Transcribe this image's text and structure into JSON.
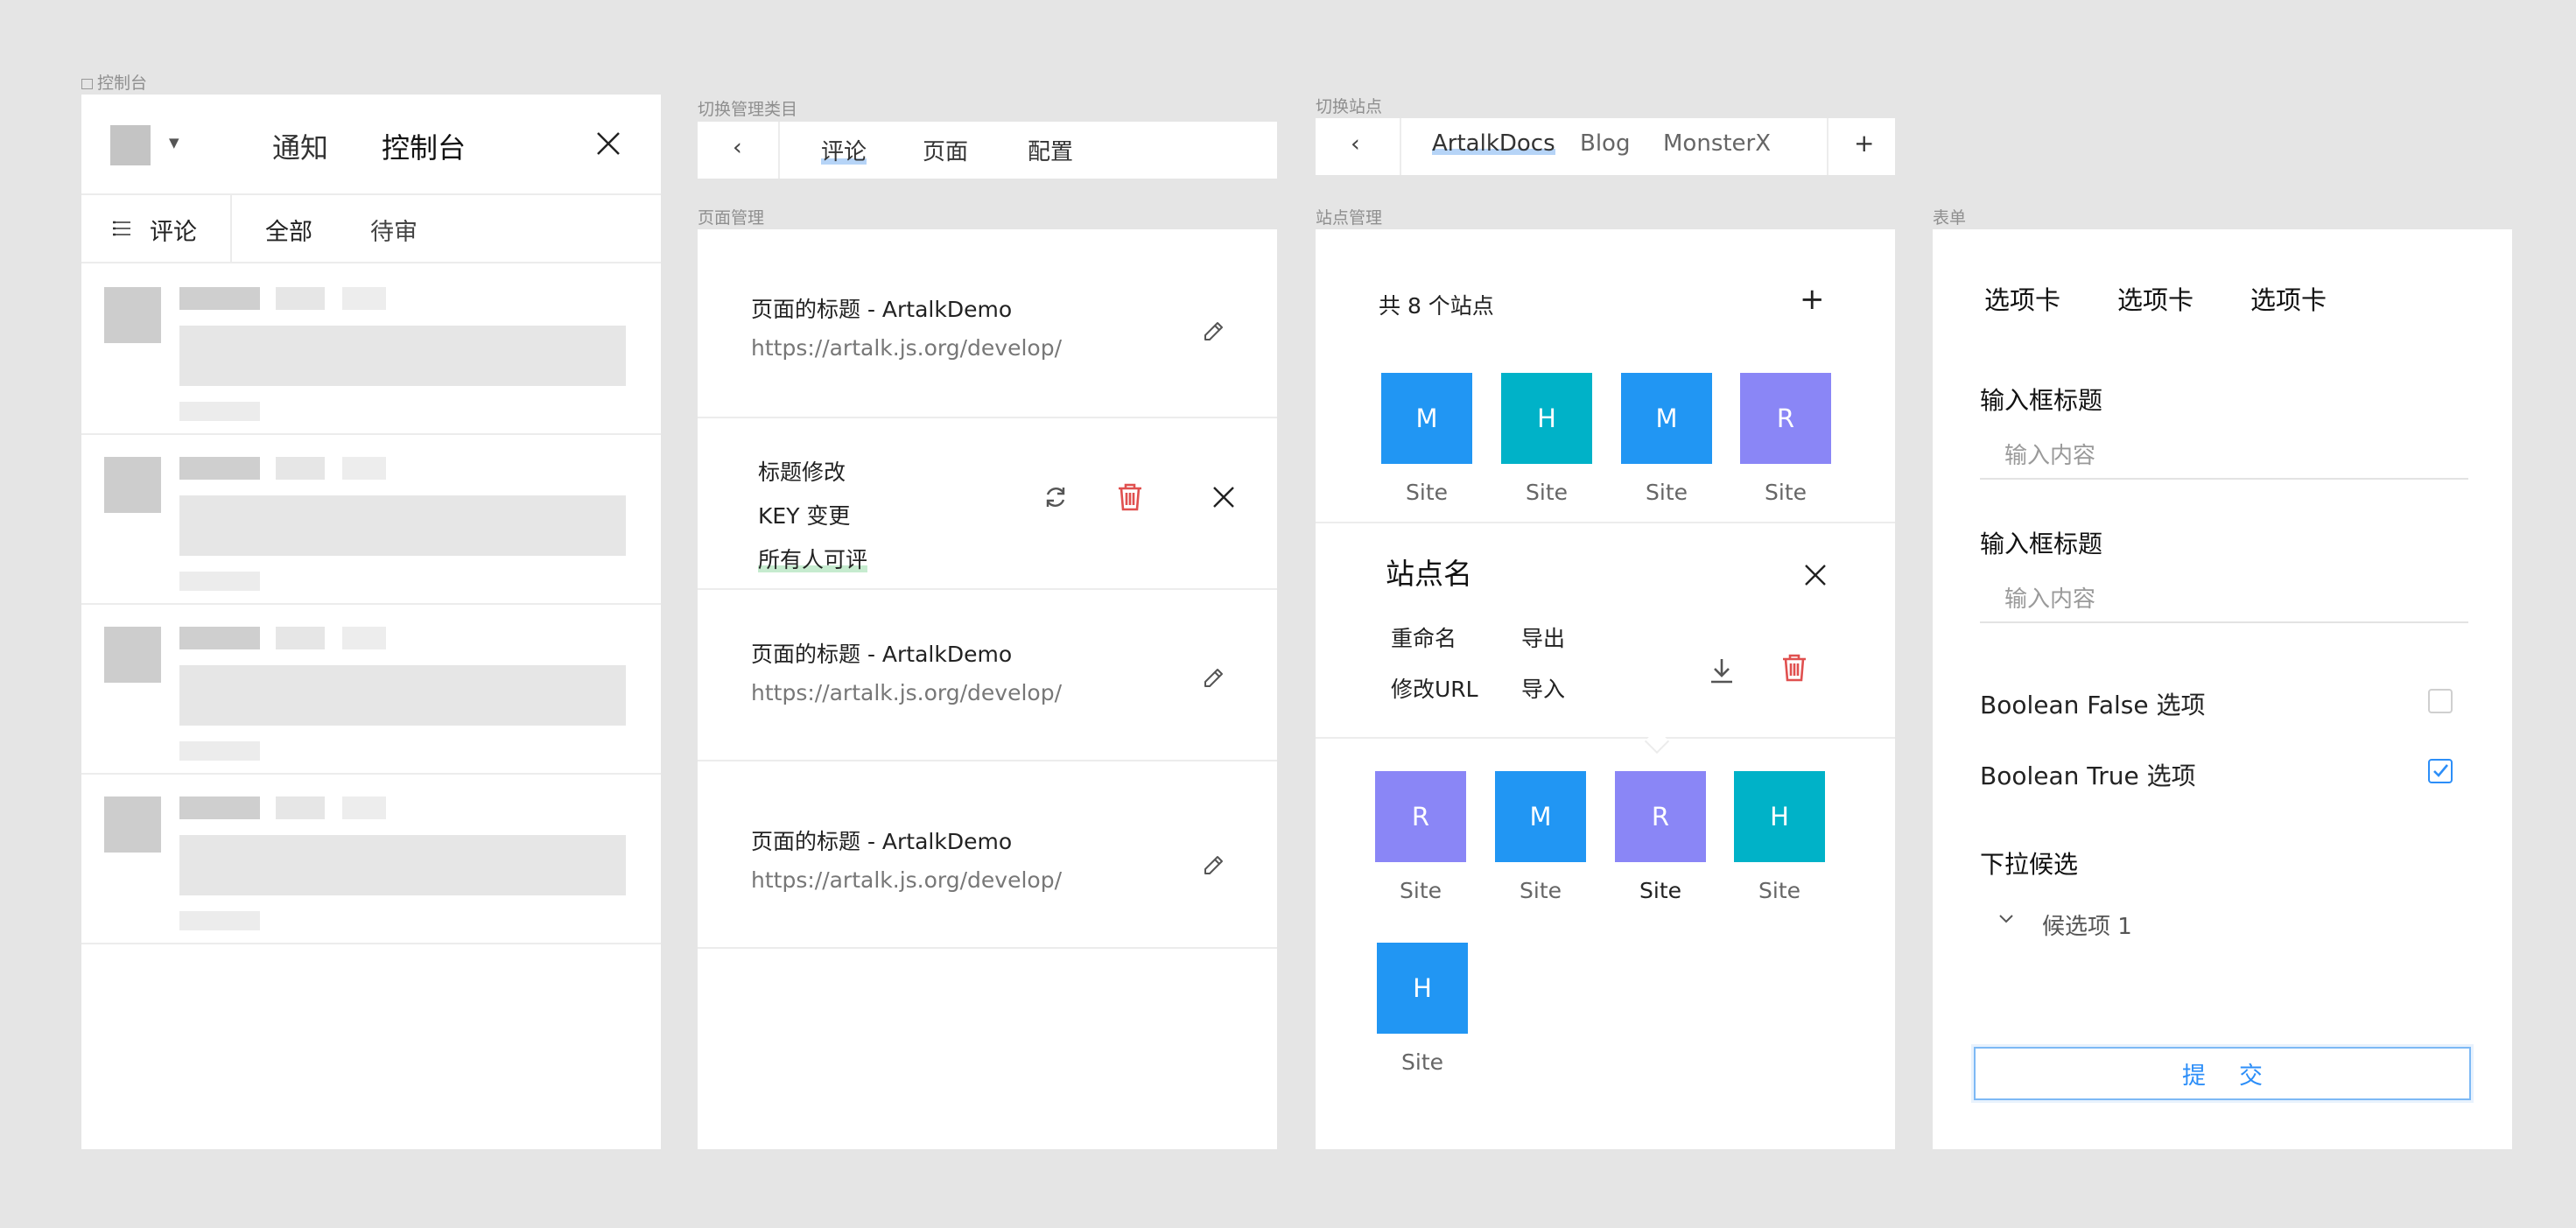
{
  "captions": {
    "console": "控制台",
    "switch_category": "切换管理类目",
    "page_manage": "页面管理",
    "switch_site": "切换站点",
    "site_manage": "站点管理",
    "form": "表单"
  },
  "console": {
    "tab_notify": "通知",
    "tab_console": "控制台",
    "filter_label": "评论",
    "filter_all": "全部",
    "filter_pending": "待审"
  },
  "category_nav": {
    "back": "‹",
    "items": [
      "评论",
      "页面",
      "配置"
    ]
  },
  "site_nav": {
    "back": "‹",
    "items": [
      "ArtalkDocs",
      "Blog",
      "MonsterX"
    ],
    "add": "+"
  },
  "pages": {
    "rows": [
      {
        "title": "页面的标题 - ArtalkDemo",
        "url": "https://artalk.js.org/develop/"
      },
      {
        "title": "页面的标题 - ArtalkDemo",
        "url": "https://artalk.js.org/develop/"
      },
      {
        "title": "页面的标题 - ArtalkDemo",
        "url": "https://artalk.js.org/develop/"
      }
    ],
    "edit_options": [
      "标题修改",
      "KEY 变更",
      "所有人可评"
    ]
  },
  "sites": {
    "count_text": "共 8 个站点",
    "add": "+",
    "tiles_top": [
      {
        "letter": "M",
        "label": "Site",
        "color": "#2196f3"
      },
      {
        "letter": "H",
        "label": "Site",
        "color": "#00b2c8"
      },
      {
        "letter": "M",
        "label": "Site",
        "color": "#2196f3"
      },
      {
        "letter": "R",
        "label": "Site",
        "color": "#8a86f6"
      }
    ],
    "selected_name": "站点名",
    "actions": {
      "rename": "重命名",
      "export": "导出",
      "edit_url": "修改URL",
      "import": "导入"
    },
    "tiles_bottom": [
      {
        "letter": "R",
        "label": "Site",
        "color": "#8a86f6"
      },
      {
        "letter": "M",
        "label": "Site",
        "color": "#2196f3"
      },
      {
        "letter": "R",
        "label": "Site",
        "color": "#8a86f6"
      },
      {
        "letter": "H",
        "label": "Site",
        "color": "#00b2c8"
      },
      {
        "letter": "H",
        "label": "Site",
        "color": "#2196f3"
      }
    ]
  },
  "form": {
    "tabs": [
      "选项卡",
      "选项卡",
      "选项卡"
    ],
    "input1_label": "输入框标题",
    "input1_placeholder": "输入内容",
    "input2_label": "输入框标题",
    "input2_placeholder": "输入内容",
    "bool_false_label": "Boolean False 选项",
    "bool_true_label": "Boolean True 选项",
    "dropdown_label": "下拉候选",
    "dropdown_value": "候选项 1",
    "submit": "提交"
  },
  "colors": {
    "accent": "#2c8ef8",
    "danger": "#e0504f",
    "highlight": "#b6d4f7"
  }
}
